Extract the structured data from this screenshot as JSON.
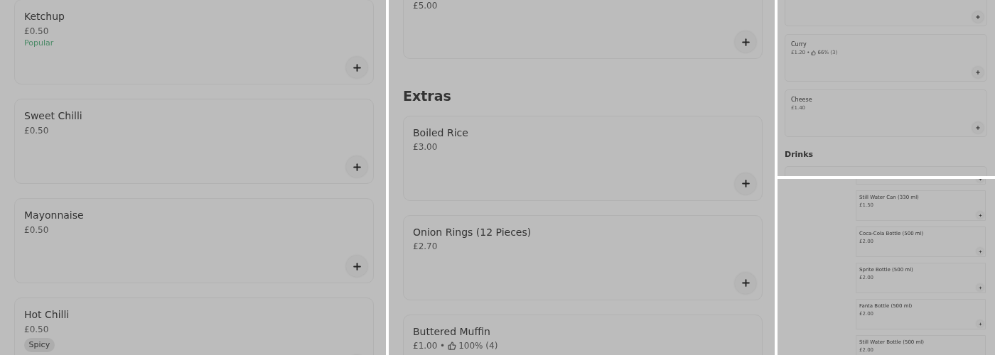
{
  "panels": [
    {
      "blocks": [
        {
          "kind": "card",
          "name": "Ketchup",
          "price": "£0.50",
          "tag": {
            "kind": "popular",
            "label": "Popular"
          }
        },
        {
          "kind": "card",
          "name": "Sweet Chilli",
          "price": "£0.50"
        },
        {
          "kind": "card",
          "name": "Mayonnaise",
          "price": "£0.50"
        },
        {
          "kind": "card",
          "name": "Hot Chilli",
          "price": "£0.50",
          "tag": {
            "kind": "spicy",
            "label": "Spicy"
          }
        }
      ]
    },
    {
      "blocks": [
        {
          "kind": "card",
          "price": "£5.00"
        },
        {
          "kind": "heading",
          "text": "Extras"
        },
        {
          "kind": "card",
          "name": "Boiled Rice",
          "price": "£3.00"
        },
        {
          "kind": "card",
          "name": "Onion Rings (12 Pieces)",
          "price": "£2.70"
        },
        {
          "kind": "card",
          "name": "Buttered Muffin",
          "price": "£1.00",
          "separator": "•",
          "rating": "100% (4)"
        }
      ]
    },
    {
      "blocks": [
        {
          "kind": "card"
        },
        {
          "kind": "card",
          "name": "Curry",
          "price": "£1.20",
          "separator": "•",
          "rating": "66% (3)"
        },
        {
          "kind": "card",
          "name": "Cheese",
          "price": "£1.40"
        },
        {
          "kind": "heading",
          "text": "Drinks"
        },
        {
          "kind": "card"
        }
      ]
    },
    {
      "blocks": [
        {
          "kind": "card"
        },
        {
          "kind": "card",
          "name": "Still Water Can (330 ml)",
          "price": "£1.50"
        },
        {
          "kind": "card",
          "name": "Coca-Cola Bottle (500 ml)",
          "price": "£2.00"
        },
        {
          "kind": "card",
          "name": "Sprite Bottle (500 ml)",
          "price": "£2.00"
        },
        {
          "kind": "card",
          "name": "Fanta Bottle (500 ml)",
          "price": "£2.00"
        },
        {
          "kind": "card",
          "name": "Still Water Bottle (500 ml)",
          "price": "£2.00"
        }
      ]
    }
  ]
}
